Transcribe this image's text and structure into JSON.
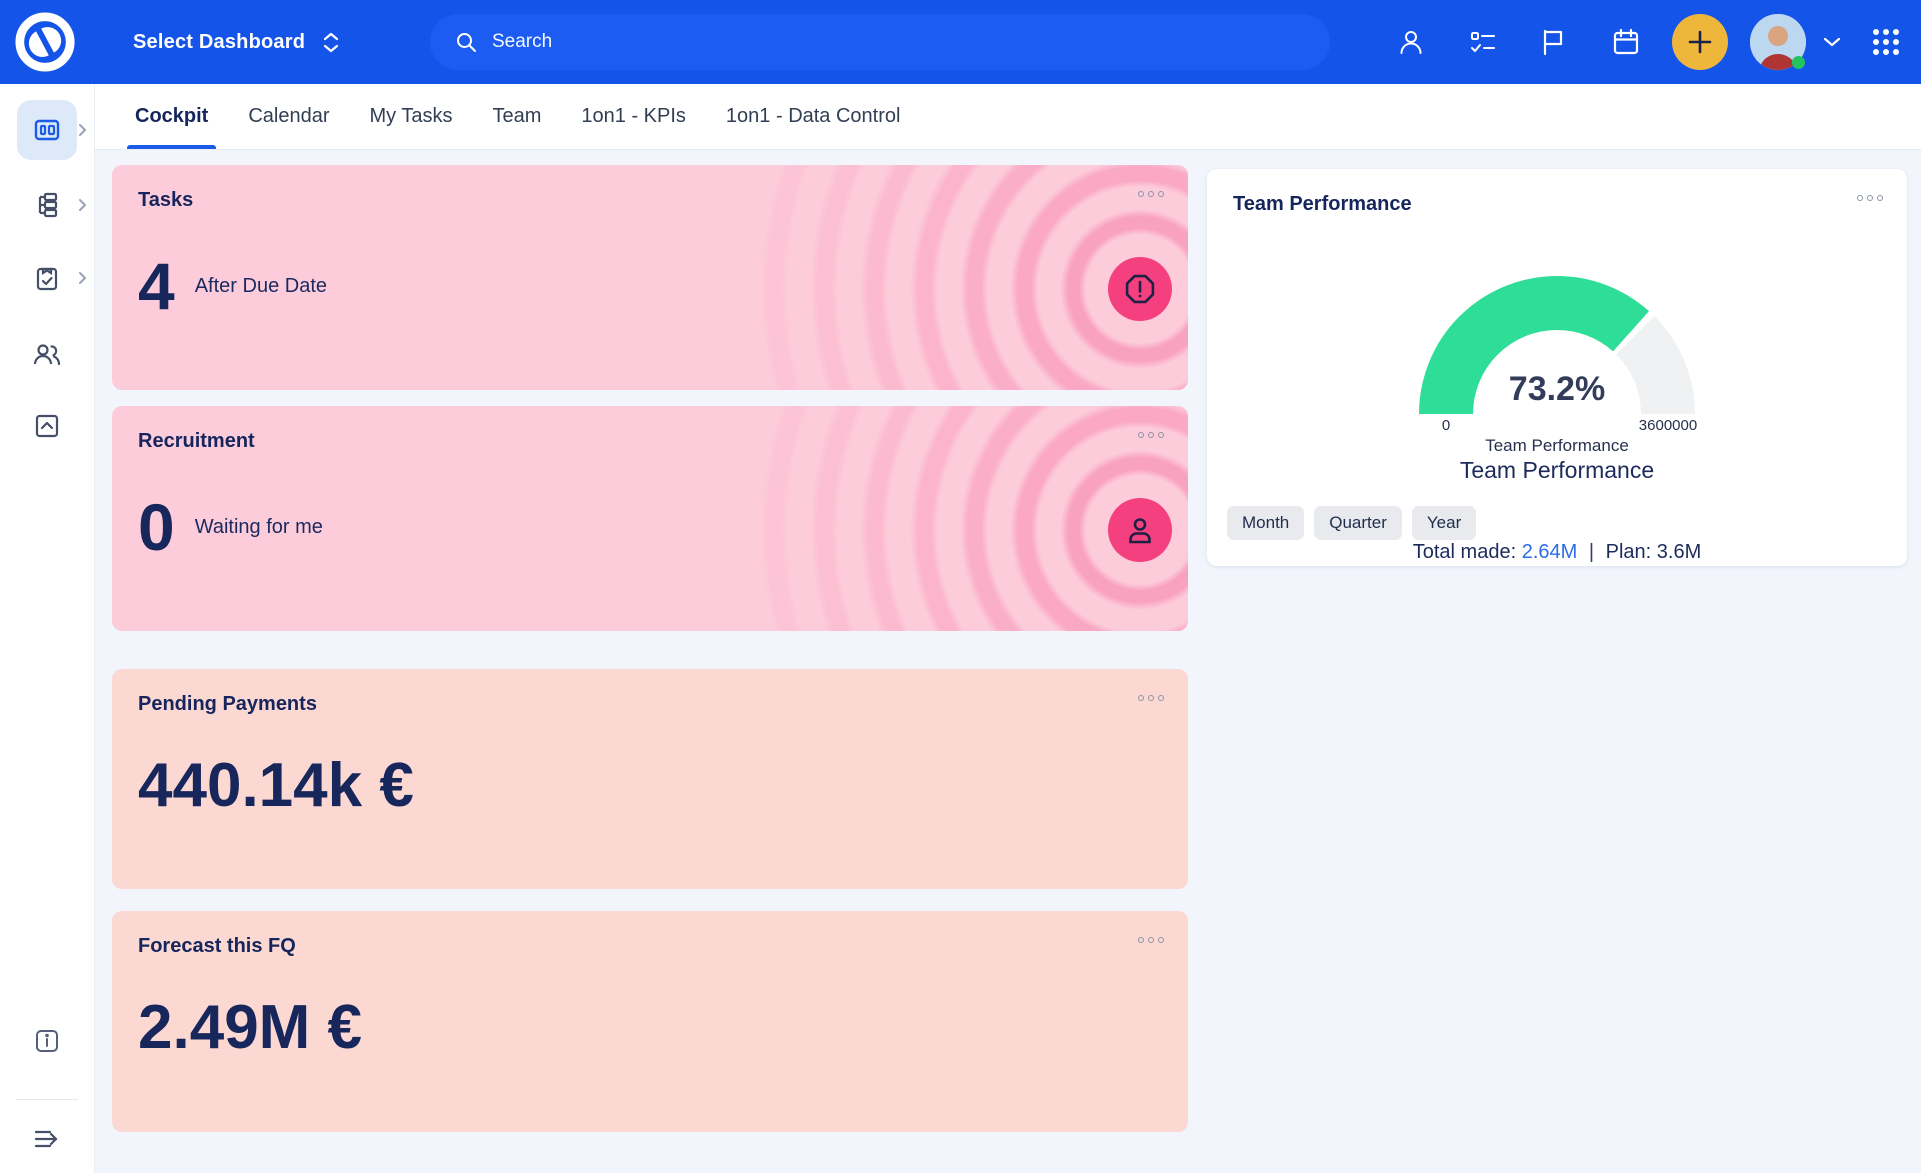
{
  "colors": {
    "header_blue": "#1554e8",
    "search_blue": "#1d5cf2",
    "accent_blue": "#1a5ce8",
    "navy_text": "#17275c",
    "pink_card": "#fdccdb",
    "salmon_card": "#fbd8d2",
    "badge_pink": "#f4407f",
    "plus_yellow": "#eeb73c",
    "gauge_green": "#2edd97",
    "gauge_track": "#f0f1f2",
    "link_blue": "#2e6ce6",
    "online_green": "#22c55e"
  },
  "header": {
    "dashboard_selector": "Select Dashboard",
    "search_placeholder": "Search"
  },
  "tabs": [
    {
      "label": "Cockpit",
      "active": true
    },
    {
      "label": "Calendar",
      "active": false
    },
    {
      "label": "My Tasks",
      "active": false
    },
    {
      "label": "Team",
      "active": false
    },
    {
      "label": "1on1 - KPIs",
      "active": false
    },
    {
      "label": "1on1 - Data Control",
      "active": false
    }
  ],
  "cards": {
    "tasks": {
      "title": "Tasks",
      "value": "4",
      "label": "After Due Date"
    },
    "recruitment": {
      "title": "Recruitment",
      "value": "0",
      "label": "Waiting for me"
    },
    "pending_payments": {
      "title": "Pending Payments",
      "value": "440.14k €"
    },
    "forecast_fq": {
      "title": "Forecast this FQ",
      "value": "2.49M €"
    }
  },
  "team_performance": {
    "title": "Team Performance",
    "percent": "73.2%",
    "gauge_min": "0",
    "gauge_max": "3600000",
    "gauge_label": "Team Performance",
    "subtitle": "Team Performance",
    "periods": [
      "Month",
      "Quarter",
      "Year"
    ],
    "total_made_label": "Total made:",
    "total_made_value": "2.64M",
    "divider": "|",
    "plan_label": "Plan:",
    "plan_value": "3.6M"
  },
  "chart_data": {
    "type": "gauge",
    "title": "Team Performance",
    "value_percent": 73.2,
    "min": 0,
    "max": 3600000,
    "total_made": "2.64M",
    "plan": "3.6M",
    "arc_color": "#2edd97",
    "track_color": "#f0f1f2"
  }
}
